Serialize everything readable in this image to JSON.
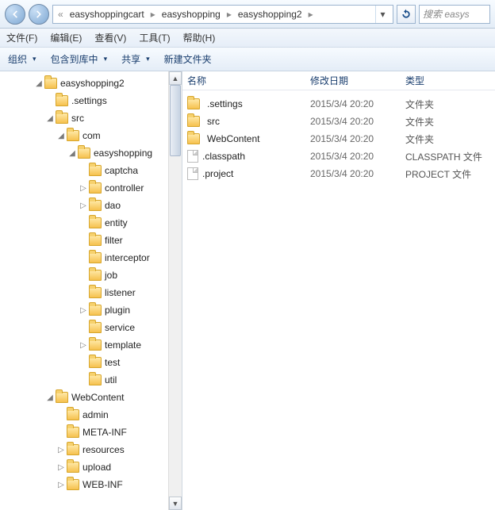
{
  "breadcrumbs": {
    "prefix": "«",
    "p1": "easyshoppingcart",
    "p2": "easyshopping",
    "p3": "easyshopping2"
  },
  "search": {
    "placeholder": "搜索 easys"
  },
  "menubar": {
    "file": "文件(F)",
    "edit": "编辑(E)",
    "view": "查看(V)",
    "tools": "工具(T)",
    "help": "帮助(H)"
  },
  "toolbar": {
    "organize": "组织",
    "include": "包含到库中",
    "share": "共享",
    "newfolder": "新建文件夹"
  },
  "columns": {
    "name": "名称",
    "modified": "修改日期",
    "type": "类型"
  },
  "tree": [
    {
      "depth": 3,
      "tw": "◢",
      "label": "easyshopping2"
    },
    {
      "depth": 4,
      "tw": "",
      "label": ".settings"
    },
    {
      "depth": 4,
      "tw": "◢",
      "label": "src"
    },
    {
      "depth": 5,
      "tw": "◢",
      "label": "com"
    },
    {
      "depth": 6,
      "tw": "◢",
      "label": "easyshopping"
    },
    {
      "depth": 7,
      "tw": "",
      "label": "captcha"
    },
    {
      "depth": 7,
      "tw": "▷",
      "label": "controller"
    },
    {
      "depth": 7,
      "tw": "▷",
      "label": "dao"
    },
    {
      "depth": 7,
      "tw": "",
      "label": "entity"
    },
    {
      "depth": 7,
      "tw": "",
      "label": "filter"
    },
    {
      "depth": 7,
      "tw": "",
      "label": "interceptor"
    },
    {
      "depth": 7,
      "tw": "",
      "label": "job"
    },
    {
      "depth": 7,
      "tw": "",
      "label": "listener"
    },
    {
      "depth": 7,
      "tw": "▷",
      "label": "plugin"
    },
    {
      "depth": 7,
      "tw": "",
      "label": "service"
    },
    {
      "depth": 7,
      "tw": "▷",
      "label": "template"
    },
    {
      "depth": 7,
      "tw": "",
      "label": "test"
    },
    {
      "depth": 7,
      "tw": "",
      "label": "util"
    },
    {
      "depth": 4,
      "tw": "◢",
      "label": "WebContent"
    },
    {
      "depth": 5,
      "tw": "",
      "label": "admin"
    },
    {
      "depth": 5,
      "tw": "",
      "label": "META-INF"
    },
    {
      "depth": 5,
      "tw": "▷",
      "label": "resources"
    },
    {
      "depth": 5,
      "tw": "▷",
      "label": "upload"
    },
    {
      "depth": 5,
      "tw": "▷",
      "label": "WEB-INF"
    }
  ],
  "rows": [
    {
      "icon": "folder",
      "name": ".settings",
      "date": "2015/3/4 20:20",
      "type": "文件夹"
    },
    {
      "icon": "folder",
      "name": "src",
      "date": "2015/3/4 20:20",
      "type": "文件夹"
    },
    {
      "icon": "folder",
      "name": "WebContent",
      "date": "2015/3/4 20:20",
      "type": "文件夹"
    },
    {
      "icon": "file",
      "name": ".classpath",
      "date": "2015/3/4 20:20",
      "type": "CLASSPATH 文件"
    },
    {
      "icon": "file",
      "name": ".project",
      "date": "2015/3/4 20:20",
      "type": "PROJECT 文件"
    }
  ]
}
